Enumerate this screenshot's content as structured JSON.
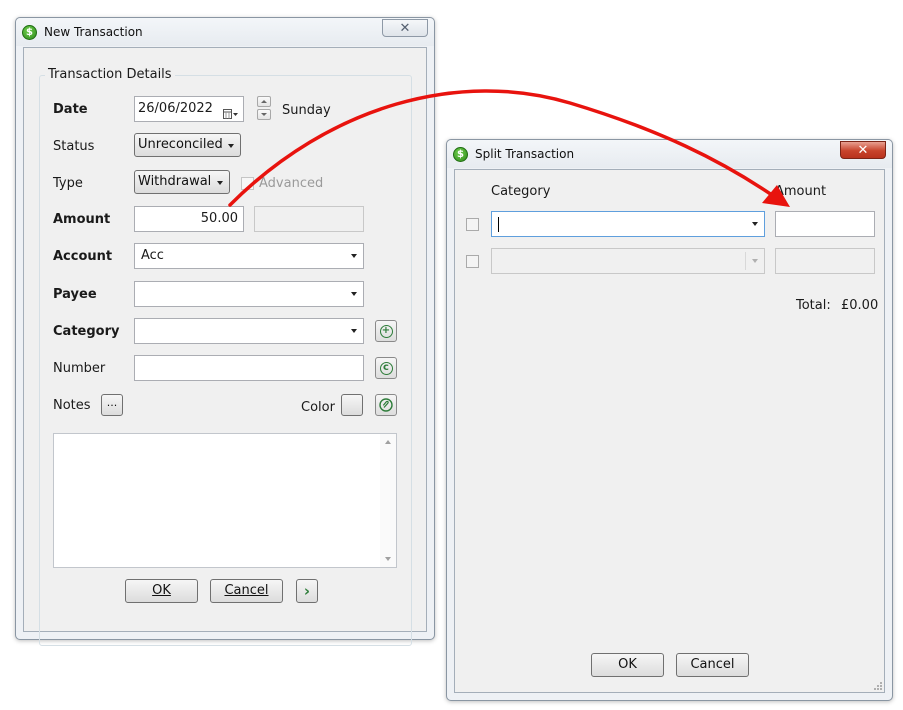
{
  "new_transaction": {
    "title": "New Transaction",
    "close_glyph": "✕",
    "group_title": "Transaction Details",
    "date": {
      "label": "Date",
      "value": "26/06/2022",
      "weekday": "Sunday"
    },
    "status": {
      "label": "Status",
      "value": "Unreconciled"
    },
    "type": {
      "label": "Type",
      "value": "Withdrawal",
      "advanced_label": "Advanced",
      "advanced_checked": false
    },
    "amount": {
      "label": "Amount",
      "value": "50.00",
      "secondary_value": ""
    },
    "account": {
      "label": "Account",
      "value": "Acc"
    },
    "payee": {
      "label": "Payee",
      "value": ""
    },
    "category": {
      "label": "Category",
      "value": ""
    },
    "number": {
      "label": "Number",
      "value": ""
    },
    "notes": {
      "label": "Notes",
      "button_label": "...",
      "value": ""
    },
    "color": {
      "label": "Color"
    },
    "buttons": {
      "ok": "OK",
      "cancel": "Cancel",
      "next_glyph": "›"
    }
  },
  "split_transaction": {
    "title": "Split Transaction",
    "close_glyph": "✕",
    "headers": {
      "category": "Category",
      "amount": "Amount"
    },
    "rows": [
      {
        "checked": false,
        "category": "",
        "amount": "",
        "enabled": true
      },
      {
        "checked": false,
        "category": "",
        "amount": "",
        "enabled": false
      }
    ],
    "total_label": "Total:",
    "total_value": "£0.00",
    "buttons": {
      "ok": "OK",
      "cancel": "Cancel"
    }
  },
  "annotation": {
    "arrow_color": "#e8130e"
  },
  "icons": {
    "app": "dollar-coin-icon",
    "calendar": "calendar-icon",
    "add_category": "plus-circle-icon",
    "number_reset": "refresh-circle-icon",
    "attachment": "paperclip-icon"
  }
}
